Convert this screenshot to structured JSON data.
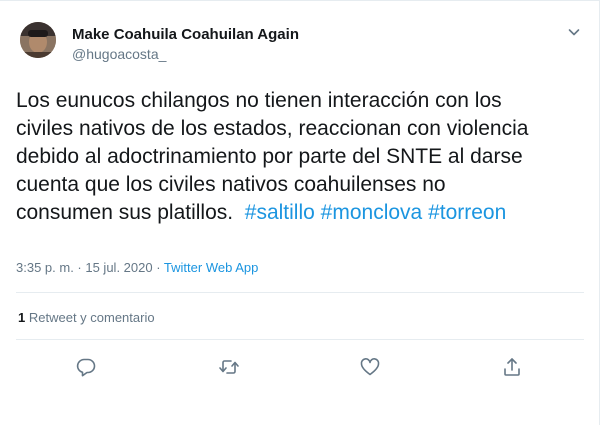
{
  "user": {
    "display_name": "Make Coahuila Coahuilan Again",
    "handle": "@hugoacosta_"
  },
  "tweet": {
    "lines": [
      "Los eunucos chilangos no tienen interacción con los",
      "civiles nativos de los estados, reaccionan con violencia",
      "debido al adoctrinamiento por parte del SNTE al darse",
      "cuenta que los civiles nativos coahuilenses no"
    ],
    "last_line_text": "consumen sus platillos.",
    "hashtags": [
      "#saltillo",
      "#monclova",
      "#torreon"
    ]
  },
  "meta": {
    "timestamp": "3:35 p. m. · 15 jul. 2020",
    "separator": " · ",
    "source": "Twitter Web App"
  },
  "stats": {
    "retweet_count": "1",
    "retweet_label": "Retweet y comentario"
  },
  "icons": {
    "caret": "chevron-down-icon",
    "reply": "reply-icon",
    "retweet": "retweet-icon",
    "like": "heart-icon",
    "share": "share-icon"
  },
  "colors": {
    "accent": "#1b95e0",
    "secondary_text": "#657786",
    "primary_text": "#14171a",
    "divider": "#e6ecf0"
  }
}
